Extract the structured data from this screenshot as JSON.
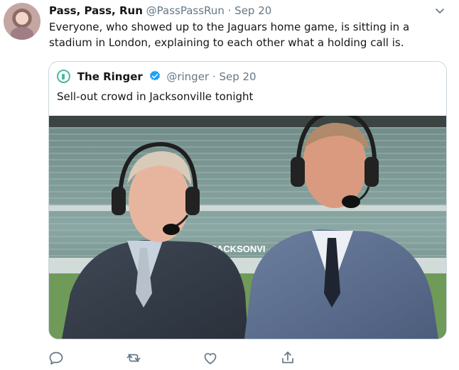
{
  "tweet": {
    "display_name": "Pass, Pass, Run",
    "handle": "@PassPassRun",
    "separator": "·",
    "date": "Sep 20",
    "text": "Everyone, who showed up to the Jaguars home game, is sitting in a stadium in London, explaining to each other what a holding call is."
  },
  "quoted_tweet": {
    "display_name": "The Ringer",
    "handle": "@ringer",
    "separator": "·",
    "date": "Sep 20",
    "text": "Sell-out crowd in Jacksonville tonight",
    "media_caption_visible": "#SACKSONVI"
  },
  "actions": {
    "reply_icon": "reply-icon",
    "retweet_icon": "retweet-icon",
    "like_icon": "heart-icon",
    "share_icon": "share-icon"
  },
  "colors": {
    "name": "#14171a",
    "secondary": "#657786",
    "border": "#ccd6dd",
    "verified": "#1da1f2",
    "ringer_logo": "#4bb6a0"
  }
}
